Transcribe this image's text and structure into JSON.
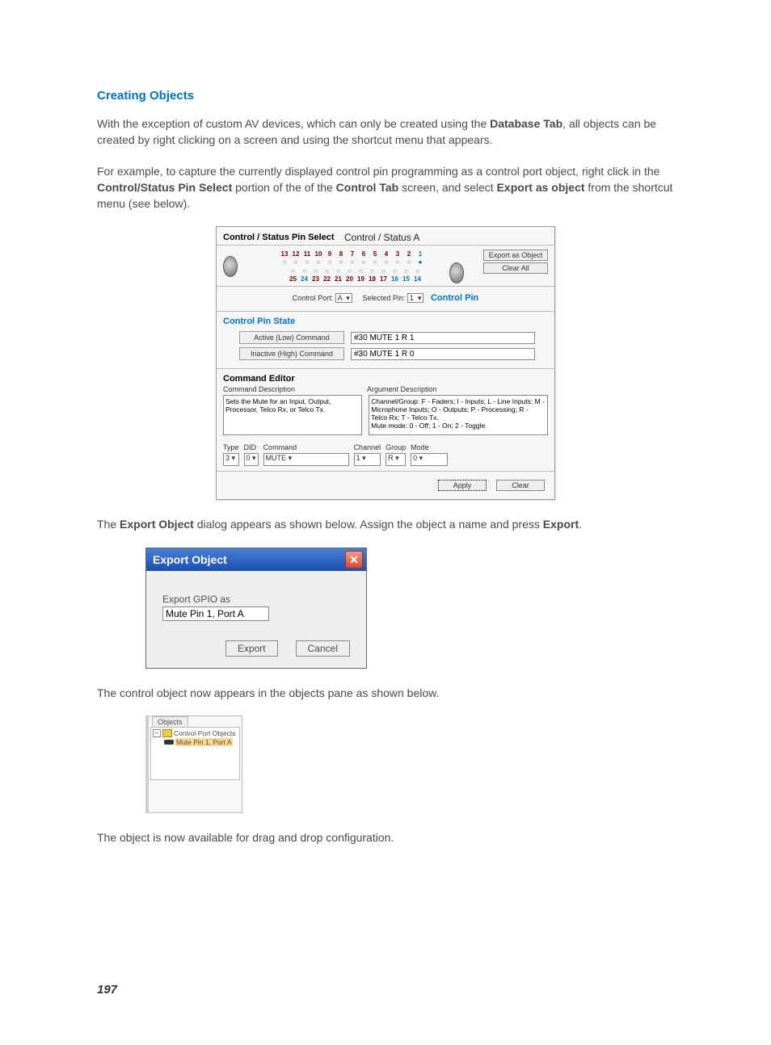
{
  "heading": "Creating Objects",
  "para1_pre": "With the exception of custom AV devices, which can only be created using the ",
  "para1_bold": "Database Tab",
  "para1_post": ", all objects can be created by right clicking on a screen and using the shortcut menu that appears.",
  "para2_a": "For example, to capture the currently displayed control pin programming as a control port object, right click in the ",
  "para2_b1": "Control/Status Pin Select",
  "para2_c": " portion of the of the ",
  "para2_b2": "Control Tab",
  "para2_d": " screen, and select ",
  "para2_b3": "Export as object",
  "para2_e": " from the shortcut menu (see below).",
  "panel": {
    "header_left": "Control / Status Pin Select",
    "header_right": "Control / Status A",
    "pins_top": [
      "13",
      "12",
      "11",
      "10",
      "9",
      "8",
      "7",
      "6",
      "5",
      "4",
      "3",
      "2",
      "1"
    ],
    "pins_bottom": [
      "25",
      "24",
      "23",
      "22",
      "21",
      "20",
      "19",
      "18",
      "17",
      "16",
      "15",
      "14"
    ],
    "btn_export": "Export as Object",
    "btn_clear": "Clear All",
    "control_port_lbl": "Control Port:",
    "control_port_val": "A",
    "selected_pin_lbl": "Selected Pin:",
    "selected_pin_val": "1",
    "control_pin_head": "Control Pin",
    "cps_title": "Control Pin State",
    "active_lbl": "Active (Low) Command",
    "active_val": "#30 MUTE 1 R 1",
    "inactive_lbl": "Inactive (High) Command",
    "inactive_val": "#30 MUTE 1 R 0",
    "ce_title": "Command Editor",
    "cmd_desc_lbl": "Command Description",
    "arg_desc_lbl": "Argument Description",
    "cmd_desc_txt": "Sets the Mute for an Input, Output, Processor, Telco Rx, or Telco Tx.",
    "arg_desc_txt": "Channel/Group: F - Faders; I - Inputs; L - Line Inputs; M - Microphone Inputs; O - Outputs; P - Processing; R - Telco Rx; T - Telco Tx.\nMute mode: 0 - Off; 1 - On; 2 - Toggle.",
    "p_type": "Type",
    "p_type_v": "3",
    "p_did": "DID",
    "p_did_v": "0",
    "p_cmd": "Command",
    "p_cmd_v": "MUTE",
    "p_ch": "Channel",
    "p_ch_v": "1",
    "p_grp": "Group",
    "p_grp_v": "R",
    "p_mode": "Mode",
    "p_mode_v": "0",
    "apply": "Apply",
    "clear": "Clear"
  },
  "para3_a": "The ",
  "para3_b1": "Export Object",
  "para3_c": " dialog appears as shown below. Assign the object a name and press ",
  "para3_b2": "Export",
  "para3_d": ".",
  "dialog": {
    "title": "Export Object",
    "group_lbl": "Export GPIO as",
    "input_val": "Mute Pin 1, Port A",
    "export": "Export",
    "cancel": "Cancel"
  },
  "para4": "The control object now appears in the objects pane as shown below.",
  "objects": {
    "tab": "Objects",
    "folder": "Control Port Objects",
    "item": "Mute Pin 1, Port A"
  },
  "para5": "The object is now available for drag and drop configuration.",
  "page_number": "197"
}
